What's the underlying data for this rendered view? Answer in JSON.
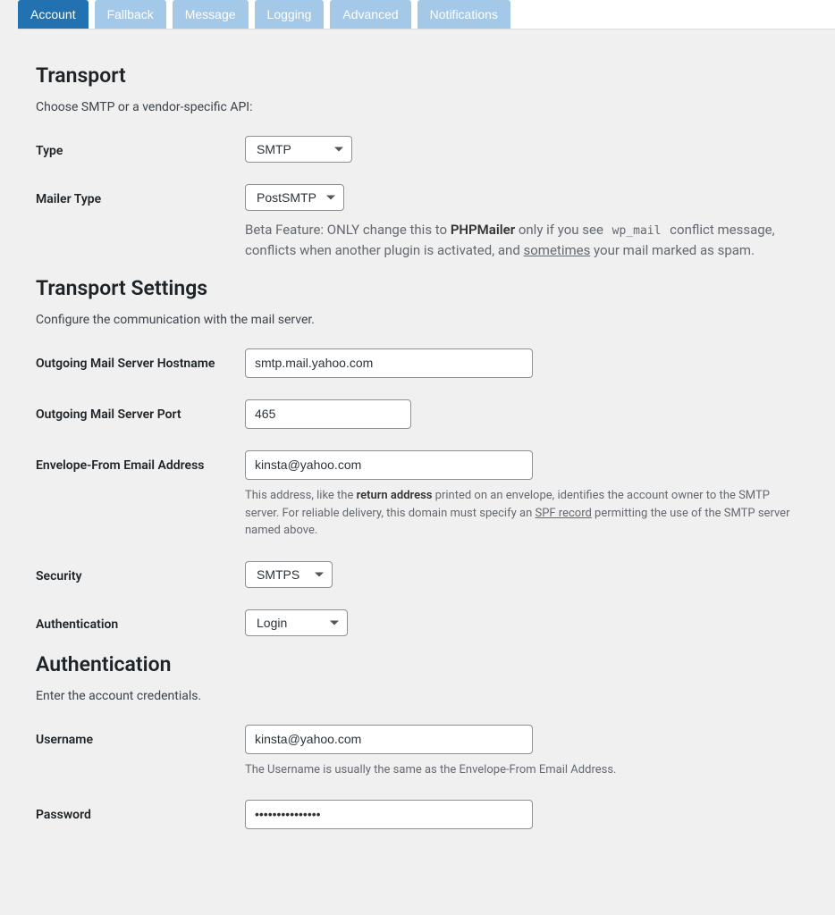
{
  "tabs": [
    {
      "label": "Account",
      "active": true
    },
    {
      "label": "Fallback",
      "active": false
    },
    {
      "label": "Message",
      "active": false
    },
    {
      "label": "Logging",
      "active": false
    },
    {
      "label": "Advanced",
      "active": false
    },
    {
      "label": "Notifications",
      "active": false
    }
  ],
  "transport": {
    "heading": "Transport",
    "description": "Choose SMTP or a vendor-specific API:",
    "type_label": "Type",
    "type_value": "SMTP",
    "mailer_label": "Mailer Type",
    "mailer_value": "PostSMTP",
    "mailer_help_prefix": "Beta Feature: ONLY change this to ",
    "mailer_help_phpmailer": "PHPMailer",
    "mailer_help_mid1": " only if you see ",
    "mailer_help_code": "wp_mail",
    "mailer_help_mid2": " conflict message, conflicts when another plugin is activated, and ",
    "mailer_help_sometimes": "sometimes",
    "mailer_help_suffix": " your mail marked as spam."
  },
  "transport_settings": {
    "heading": "Transport Settings",
    "description": "Configure the communication with the mail server.",
    "hostname_label": "Outgoing Mail Server Hostname",
    "hostname_value": "smtp.mail.yahoo.com",
    "port_label": "Outgoing Mail Server Port",
    "port_value": "465",
    "envelope_label": "Envelope-From Email Address",
    "envelope_value": "kinsta@yahoo.com",
    "envelope_help_prefix": "This address, like the ",
    "envelope_help_bold": "return address",
    "envelope_help_mid": " printed on an envelope, identifies the account owner to the SMTP server. For reliable delivery, this domain must specify an ",
    "envelope_help_spf": "SPF record",
    "envelope_help_suffix": " permitting the use of the SMTP server named above.",
    "security_label": "Security",
    "security_value": "SMTPS",
    "auth_label": "Authentication",
    "auth_value": "Login"
  },
  "authentication": {
    "heading": "Authentication",
    "description": "Enter the account credentials.",
    "username_label": "Username",
    "username_value": "kinsta@yahoo.com",
    "username_help": "The Username is usually the same as the Envelope-From Email Address.",
    "password_label": "Password",
    "password_value": "•••••••••••••••"
  }
}
